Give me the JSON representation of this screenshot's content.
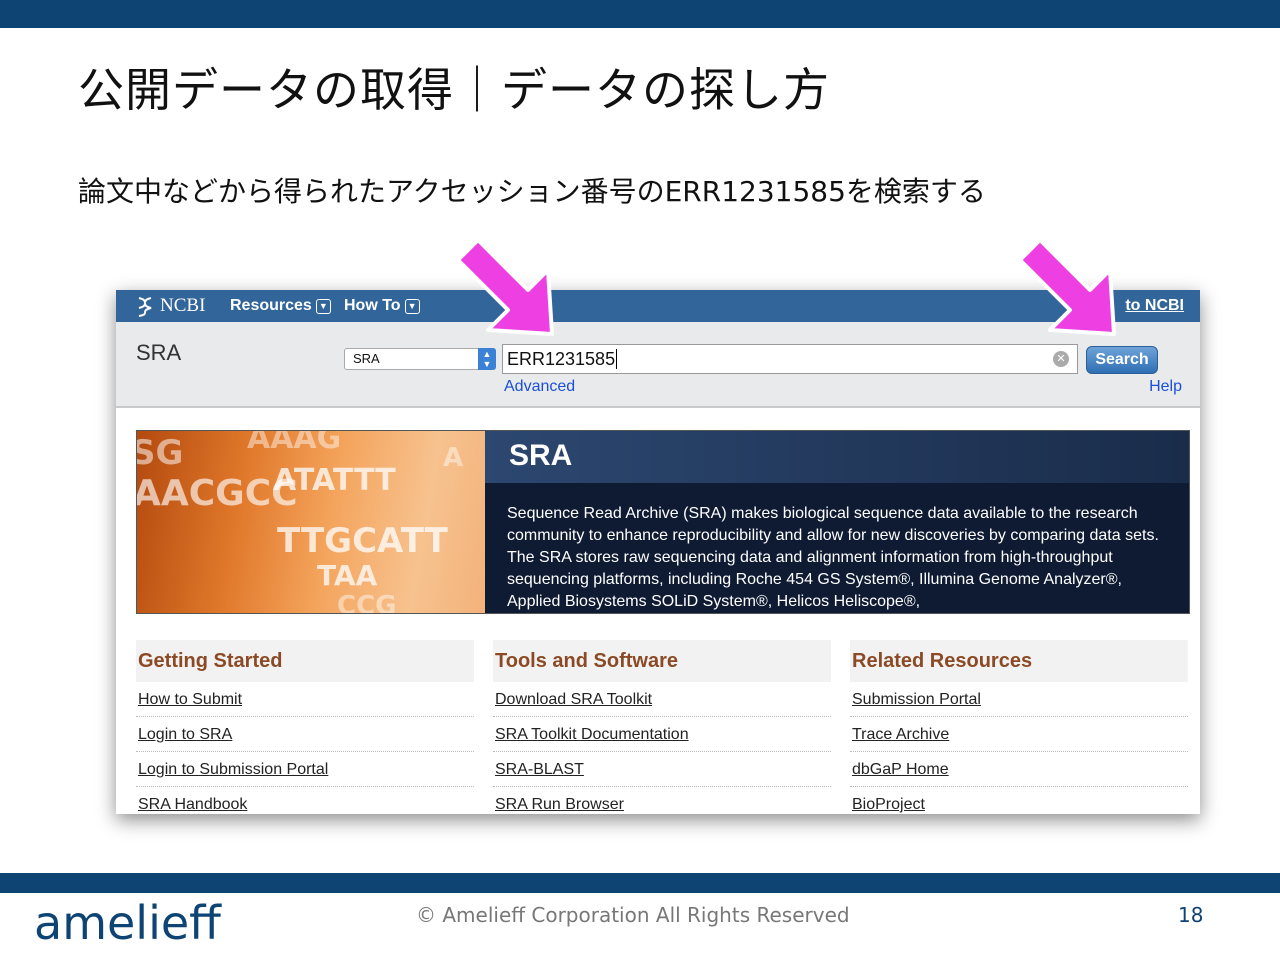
{
  "slide": {
    "title": "公開データの取得｜データの探し方",
    "subtitle": "論文中などから得られたアクセッション番号のERR1231585を検索する",
    "copyright": "© Amelieff Corporation All Rights Reserved",
    "page_number": "18",
    "brand": "amelieff"
  },
  "ncbi": {
    "logo_text": "NCBI",
    "nav": {
      "resources": "Resources",
      "how_to": "How To",
      "signin": "to NCBI"
    },
    "db_label": "SRA",
    "db_select_value": "SRA",
    "search_term": "ERR1231585",
    "search_button": "Search",
    "advanced_link": "Advanced",
    "help_link": "Help"
  },
  "banner": {
    "title": "SRA",
    "description": "Sequence Read Archive (SRA) makes biological sequence data available to the research community to enhance reproducibility and allow for new discoveries by comparing data sets. The SRA stores raw sequencing data and alignment information from high-throughput sequencing platforms, including Roche 454 GS System®, Illumina Genome Analyzer®, Applied Biosystems SOLiD System®, Helicos Heliscope®,",
    "dna": [
      "SG",
      "AAAG",
      "A",
      "ATATTT",
      "AACGCC",
      "TTGCATT",
      "TAA",
      "CCG"
    ]
  },
  "columns": [
    {
      "heading": "Getting Started",
      "links": [
        "How to Submit",
        "Login to SRA",
        "Login to Submission Portal",
        "SRA Handbook"
      ]
    },
    {
      "heading": "Tools and Software",
      "links": [
        "Download SRA Toolkit",
        "SRA Toolkit Documentation",
        "SRA-BLAST",
        "SRA Run Browser"
      ]
    },
    {
      "heading": "Related Resources",
      "links": [
        "Submission Portal",
        "Trace Archive",
        "dbGaP Home",
        "BioProject"
      ]
    }
  ],
  "colors": {
    "slide_bar": "#0e4474",
    "ncbi_nav": "#326599",
    "arrow": "#ee3fe2",
    "heading_brown": "#8b4a25"
  }
}
